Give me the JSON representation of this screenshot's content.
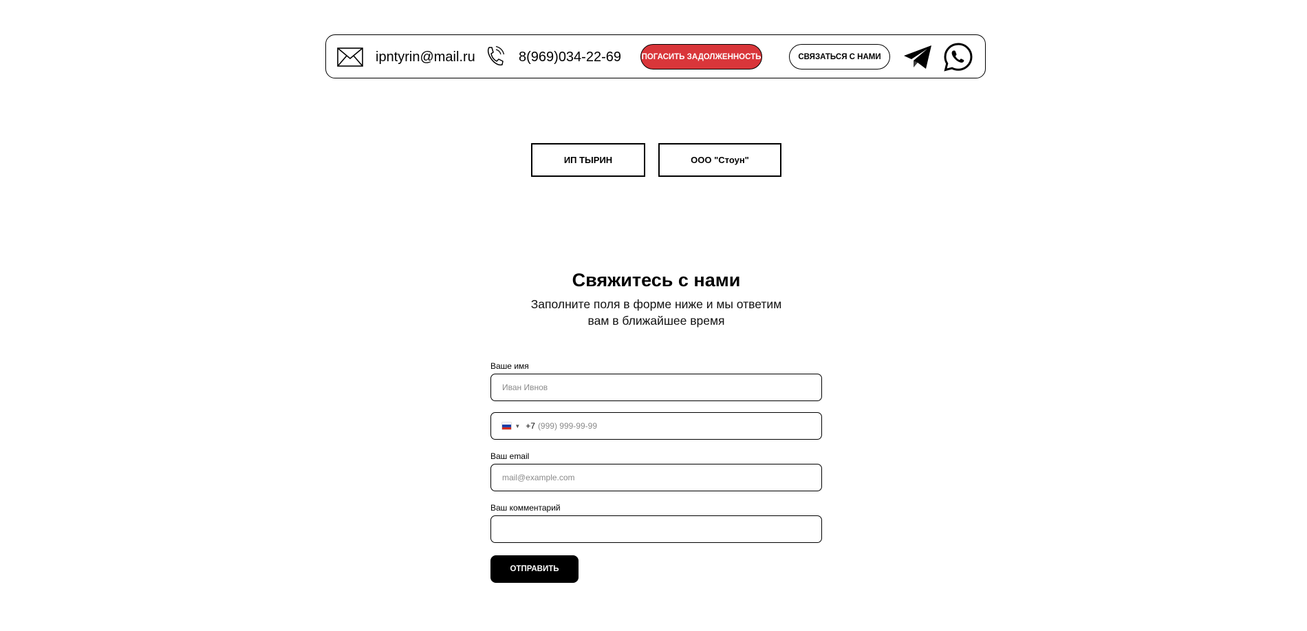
{
  "topbar": {
    "email": "ipntyrin@mail.ru",
    "phone": "8(969)034-22-69",
    "pay_button": "ПОГАСИТЬ ЗАДОЛЖЕННОСТЬ",
    "contact_button": "СВЯЗАТЬСЯ С НАМИ",
    "icons": [
      "mail-icon",
      "phone-icon",
      "telegram-icon",
      "whatsapp-icon"
    ],
    "pay_button_color": "#d9363a"
  },
  "tabs": [
    {
      "label": "ИП ТЫРИН"
    },
    {
      "label": "ООО \"Стоун\""
    }
  ],
  "form": {
    "title": "Свяжитесь с нами",
    "subtitle_line1": "Заполните поля в форме ниже и мы ответим",
    "subtitle_line2": "вам в ближайшее время",
    "name_label": "Ваше имя",
    "name_placeholder": "Иван Ивнов",
    "phone_country": "RU",
    "phone_prefix": "+7",
    "phone_placeholder": "(999) 999-99-99",
    "email_label": "Ваш email",
    "email_placeholder": "mail@example.com",
    "comment_label": "Ваш комментарий",
    "comment_placeholder": "",
    "submit_label": "ОТПРАВИТЬ"
  }
}
